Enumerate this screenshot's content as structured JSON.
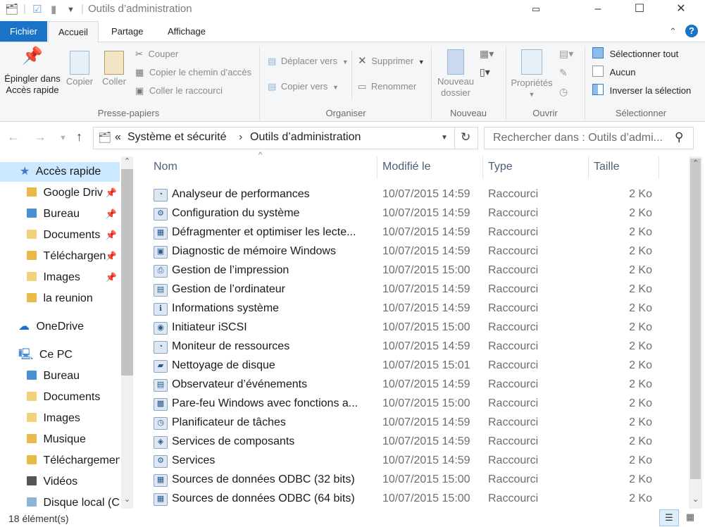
{
  "window": {
    "title": "Outils d’administration",
    "min_label": "–",
    "max_label": "☐",
    "close_label": "✕"
  },
  "tabs": [
    {
      "label": "Fichier"
    },
    {
      "label": "Accueil"
    },
    {
      "label": "Partage"
    },
    {
      "label": "Affichage"
    }
  ],
  "ribbon": {
    "clipboard": {
      "pin_label_1": "Épingler dans",
      "pin_label_2": "Accès rapide",
      "copy": "Copier",
      "paste": "Coller",
      "cut": "Couper",
      "copy_path": "Copier le chemin d’accès",
      "paste_shortcut": "Coller le raccourci",
      "group": "Presse-papiers"
    },
    "organize": {
      "move_to": "Déplacer vers",
      "copy_to": "Copier vers",
      "delete": "Supprimer",
      "rename": "Renommer",
      "group": "Organiser"
    },
    "new": {
      "new_folder_1": "Nouveau",
      "new_folder_2": "dossier",
      "group": "Nouveau"
    },
    "open": {
      "properties": "Propriétés",
      "group": "Ouvrir"
    },
    "select": {
      "select_all": "Sélectionner tout",
      "none": "Aucun",
      "invert": "Inverser la sélection",
      "group": "Sélectionner"
    }
  },
  "address": {
    "chevron": "«",
    "parent": "Système et sécurité",
    "current": "Outils d’administration"
  },
  "search": {
    "placeholder": "Rechercher dans : Outils d’admi..."
  },
  "nav": {
    "quick_access": "Accès rapide",
    "quick_items": [
      "Google Driv",
      "Bureau",
      "Documents",
      "Téléchargen",
      "Images",
      "la reunion"
    ],
    "onedrive": "OneDrive",
    "this_pc": "Ce PC",
    "pc_items": [
      "Bureau",
      "Documents",
      "Images",
      "Musique",
      "Téléchargemen",
      "Vidéos",
      "Disque local (C"
    ]
  },
  "columns": {
    "name": "Nom",
    "modified": "Modifié le",
    "type": "Type",
    "size": "Taille"
  },
  "files": [
    {
      "name": "Analyseur de performances",
      "date": "10/07/2015 14:59",
      "type": "Raccourci",
      "size": "2 Ko"
    },
    {
      "name": "Configuration du système",
      "date": "10/07/2015 14:59",
      "type": "Raccourci",
      "size": "2 Ko"
    },
    {
      "name": "Défragmenter et optimiser les lecte...",
      "date": "10/07/2015 14:59",
      "type": "Raccourci",
      "size": "2 Ko"
    },
    {
      "name": "Diagnostic de mémoire Windows",
      "date": "10/07/2015 14:59",
      "type": "Raccourci",
      "size": "2 Ko"
    },
    {
      "name": "Gestion de l’impression",
      "date": "10/07/2015 15:00",
      "type": "Raccourci",
      "size": "2 Ko"
    },
    {
      "name": "Gestion de l’ordinateur",
      "date": "10/07/2015 14:59",
      "type": "Raccourci",
      "size": "2 Ko"
    },
    {
      "name": "Informations système",
      "date": "10/07/2015 14:59",
      "type": "Raccourci",
      "size": "2 Ko"
    },
    {
      "name": "Initiateur iSCSI",
      "date": "10/07/2015 15:00",
      "type": "Raccourci",
      "size": "2 Ko"
    },
    {
      "name": "Moniteur de ressources",
      "date": "10/07/2015 14:59",
      "type": "Raccourci",
      "size": "2 Ko"
    },
    {
      "name": "Nettoyage de disque",
      "date": "10/07/2015 15:01",
      "type": "Raccourci",
      "size": "2 Ko"
    },
    {
      "name": "Observateur d’événements",
      "date": "10/07/2015 14:59",
      "type": "Raccourci",
      "size": "2 Ko"
    },
    {
      "name": "Pare-feu Windows avec fonctions a...",
      "date": "10/07/2015 15:00",
      "type": "Raccourci",
      "size": "2 Ko"
    },
    {
      "name": "Planificateur de tâches",
      "date": "10/07/2015 14:59",
      "type": "Raccourci",
      "size": "2 Ko"
    },
    {
      "name": "Services de composants",
      "date": "10/07/2015 14:59",
      "type": "Raccourci",
      "size": "2 Ko"
    },
    {
      "name": "Services",
      "date": "10/07/2015 14:59",
      "type": "Raccourci",
      "size": "2 Ko"
    },
    {
      "name": "Sources de données ODBC (32 bits)",
      "date": "10/07/2015 15:00",
      "type": "Raccourci",
      "size": "2 Ko"
    },
    {
      "name": "Sources de données ODBC (64 bits)",
      "date": "10/07/2015 15:00",
      "type": "Raccourci",
      "size": "2 Ko"
    }
  ],
  "status": {
    "count": "18 élément(s)"
  },
  "colors": {
    "file_tab": "#1a73c7",
    "selection": "#cce8ff",
    "header_text": "#4c607a"
  }
}
